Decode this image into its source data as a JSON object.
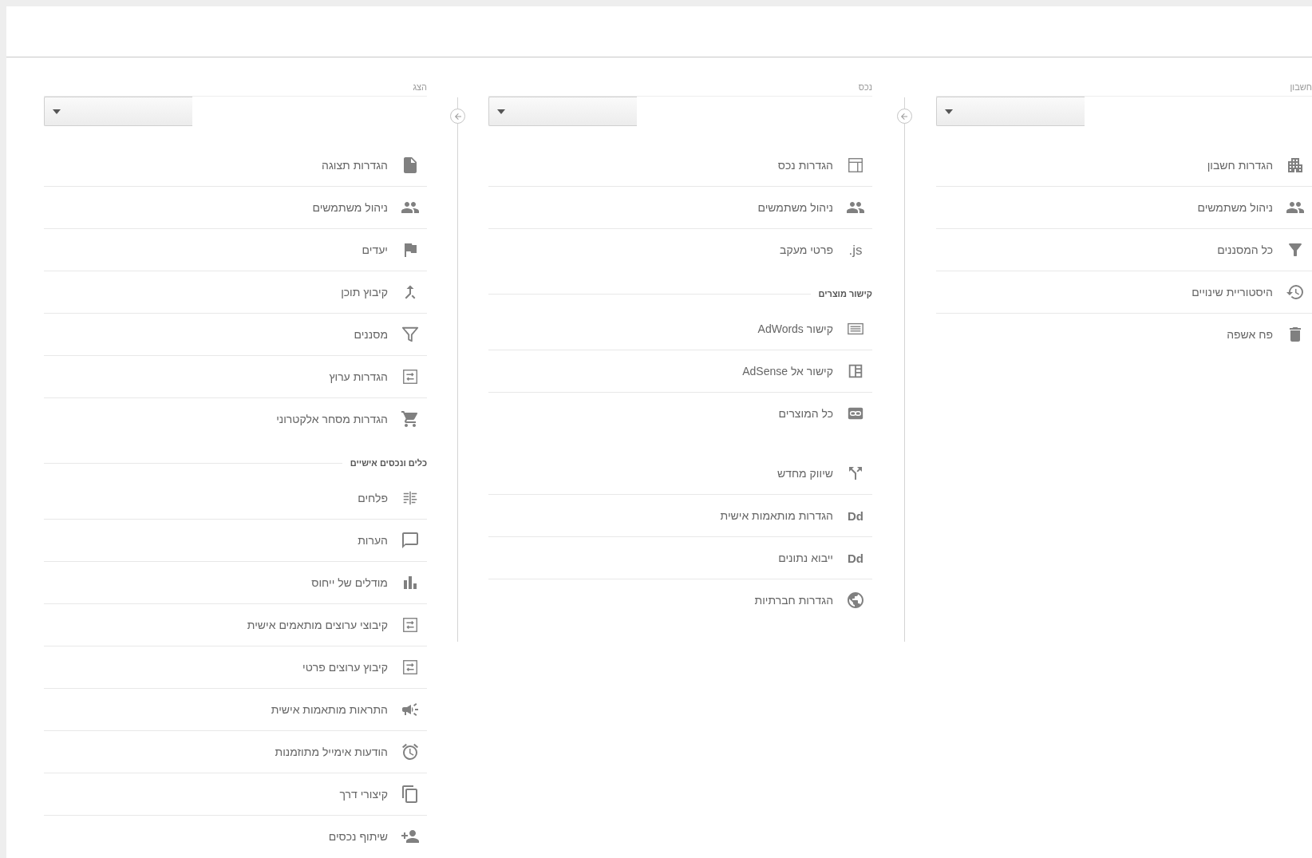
{
  "columns": [
    {
      "heading": "חשבון",
      "sections": [
        {
          "items": [
            {
              "label": "הגדרות חשבון"
            },
            {
              "label": "ניהול משתמשים"
            },
            {
              "label": "כל המסננים"
            },
            {
              "label": "היסטוריית שינויים"
            },
            {
              "label": "פח אשפה"
            }
          ]
        }
      ]
    },
    {
      "heading": "נכס",
      "sections": [
        {
          "items": [
            {
              "label": "הגדרות נכס"
            },
            {
              "label": "ניהול משתמשים"
            },
            {
              "label": "פרטי מעקב",
              "glyph": ".js"
            }
          ]
        },
        {
          "title": "קישור מוצרים",
          "items": [
            {
              "label": "קישור AdWords"
            },
            {
              "label": "קישור אל AdSense"
            },
            {
              "label": "כל המוצרים"
            }
          ]
        },
        {
          "items": [
            {
              "label": "שיווק מחדש"
            },
            {
              "label": "הגדרות מותאמות אישית",
              "glyph": "Dd"
            },
            {
              "label": "ייבוא נתונים",
              "glyph": "Dd"
            },
            {
              "label": "הגדרות חברתיות"
            }
          ]
        }
      ]
    },
    {
      "heading": "הצג",
      "sections": [
        {
          "items": [
            {
              "label": "הגדרות תצוגה"
            },
            {
              "label": "ניהול משתמשים"
            },
            {
              "label": "יעדים"
            },
            {
              "label": "קיבוץ תוכן"
            },
            {
              "label": "מסננים"
            },
            {
              "label": "הגדרות ערוץ"
            },
            {
              "label": "הגדרות מסחר אלקטרוני"
            }
          ]
        },
        {
          "title": "כלים ונכסים אישיים",
          "items": [
            {
              "label": "פלחים"
            },
            {
              "label": "הערות"
            },
            {
              "label": "מודלים של ייחוס"
            },
            {
              "label": "קיבוצי ערוצים מותאמים אישית"
            },
            {
              "label": "קיבוץ ערוצים פרטי"
            },
            {
              "label": "התראות מותאמות אישית"
            },
            {
              "label": "הודעות אימייל מתוזמנות"
            },
            {
              "label": "קיצורי דרך"
            },
            {
              "label": "שיתוף נכסים"
            }
          ]
        }
      ]
    }
  ]
}
